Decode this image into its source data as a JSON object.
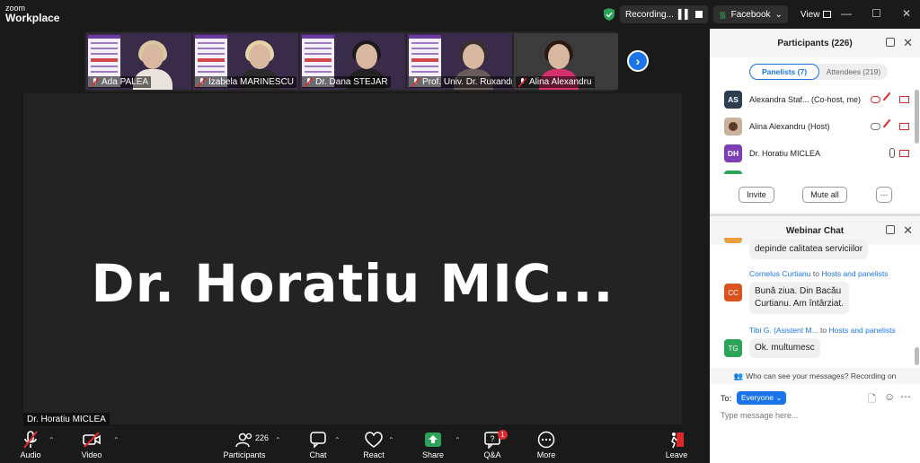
{
  "app": {
    "brand_line1": "zoom",
    "brand_line2": "Workplace"
  },
  "titlebar": {
    "recording": "Recording...",
    "facebook": "Facebook",
    "view": "View"
  },
  "thumbnails": [
    {
      "name": "Ada PALEA"
    },
    {
      "name": "Izabela MARINESCU"
    },
    {
      "name": "Dr. Dana STEJAR"
    },
    {
      "name": "Prof. Univ. Dr. Ruxandr..."
    },
    {
      "name": "Alina Alexandru"
    }
  ],
  "main_video": {
    "big_name": "Dr. Horatiu MIC...",
    "label": "Dr. Horatiu MICLEA"
  },
  "toolbar": {
    "audio": "Audio",
    "video": "Video",
    "participants": "Participants",
    "participants_count": "226",
    "chat": "Chat",
    "react": "React",
    "share": "Share",
    "qa": "Q&A",
    "qa_badge": "1",
    "more": "More",
    "leave": "Leave"
  },
  "participants_panel": {
    "title": "Participants (226)",
    "tab_panelists": "Panelists (7)",
    "tab_attendees": "Attendees (219)",
    "rows": [
      {
        "initials": "AS",
        "name": "Alexandra Staf... (Co-host, me)",
        "color": "#2d3e50"
      },
      {
        "initials": "",
        "name": "Alina Alexandru (Host)",
        "color": "#c9b39c"
      },
      {
        "initials": "DH",
        "name": "Dr. Horatiu MICLEA",
        "color": "#7b3fb3"
      }
    ],
    "invite": "Invite",
    "mute_all": "Mute all",
    "more": "···"
  },
  "chat_panel": {
    "title": "Webinar Chat",
    "partial_message": "depinde calitatea serviciilor",
    "messages": [
      {
        "sender": "Cornelus Curtianu",
        "to": "to",
        "recipient": "Hosts and panelists",
        "initials": "CC",
        "color": "#d9531e",
        "line1": "Bună ziua. Din Bacău",
        "line2": "Curtianu. Am întârziat."
      },
      {
        "sender": "Tibi G. (Asistent M...",
        "to": "to",
        "recipient": "Hosts and panelists",
        "initials": "TG",
        "color": "#2ba35a",
        "line1": "Ok. multumesc",
        "line2": ""
      }
    ],
    "notice": "Who can see your messages? Recording on",
    "to_label": "To:",
    "everyone": "Everyone",
    "input_placeholder": "Type message here..."
  }
}
